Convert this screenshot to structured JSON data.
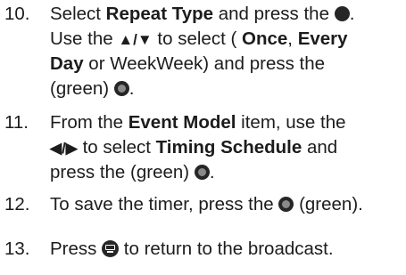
{
  "steps": [
    {
      "number": "10.",
      "lines": {
        "a1": "Select ",
        "a2": "Repeat Type",
        "a3": " and press the ",
        "a5": ".",
        "b1": "Use the ",
        "b2": "▲/▼",
        "b3": " to select ( ",
        "b4": "Once",
        "b5": ", ",
        "b6": "Every",
        "c1": "Day",
        "c2": " or WeekWeek) and press the",
        "d1": "(green) ",
        "d3": "."
      }
    },
    {
      "number": "11.",
      "lines": {
        "a1": "From the ",
        "a2": "Event Model",
        "a3": " item, use the",
        "b1": "◀/▶",
        "b2": " to select ",
        "b3": "Timing Schedule",
        "b4": " and",
        "c1": "press the (green) ",
        "c3": "."
      }
    },
    {
      "number": "12.",
      "lines": {
        "a1": "To save the timer, press the ",
        "a3": " (green)."
      }
    },
    {
      "number": "13.",
      "lines": {
        "a1": "Press ",
        "a3": " to return to the broadcast."
      }
    }
  ],
  "icons": {
    "ok_button": "filled-circle-icon",
    "green_button": "green-button-icon",
    "tv_button": "tv-button-icon"
  }
}
